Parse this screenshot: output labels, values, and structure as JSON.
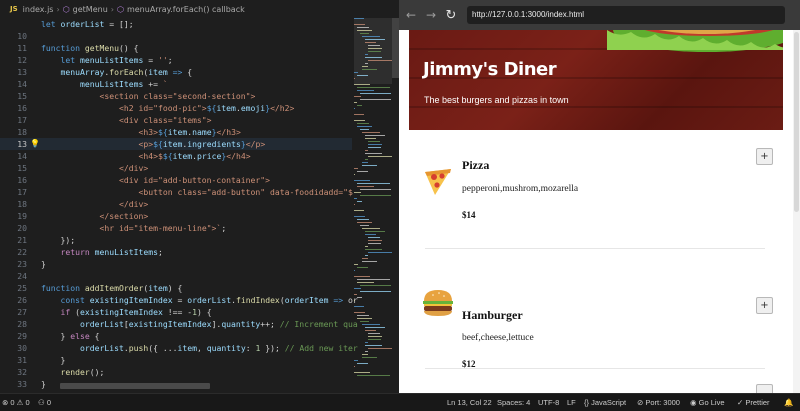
{
  "breadcrumb": {
    "lang": "JS",
    "file": "index.js",
    "sep": "›",
    "fn": "getMenu",
    "cb": "menuArray.forEach() callback"
  },
  "code_lines": [
    {
      "n": "",
      "tokens": [
        [
          "t-kw",
          "let "
        ],
        [
          "t-var",
          "orderList"
        ],
        [
          "t-op",
          " = [];"
        ]
      ]
    },
    {
      "n": "10",
      "tokens": []
    },
    {
      "n": "11",
      "tokens": [
        [
          "t-kw",
          "function "
        ],
        [
          "t-fn",
          "getMenu"
        ],
        [
          "t-op",
          "() {"
        ]
      ]
    },
    {
      "n": "12",
      "tokens": [
        [
          "t-op",
          "    "
        ],
        [
          "t-kw",
          "let "
        ],
        [
          "t-var",
          "menuListItems"
        ],
        [
          "t-op",
          " = "
        ],
        [
          "t-str",
          "''"
        ],
        [
          "t-op",
          ";"
        ]
      ]
    },
    {
      "n": "13",
      "tokens": [
        [
          "t-op",
          "    "
        ],
        [
          "t-var",
          "menuArray"
        ],
        [
          "t-op",
          "."
        ],
        [
          "t-fn",
          "forEach"
        ],
        [
          "t-op",
          "("
        ],
        [
          "t-var",
          "item"
        ],
        [
          "t-op",
          " "
        ],
        [
          "t-kw",
          "=>"
        ],
        [
          "t-op",
          " {"
        ]
      ]
    },
    {
      "n": "14",
      "tokens": [
        [
          "t-op",
          "        "
        ],
        [
          "t-var",
          "menuListItems"
        ],
        [
          "t-op",
          " += "
        ],
        [
          "t-str",
          "`"
        ]
      ]
    },
    {
      "n": "15",
      "tokens": [
        [
          "t-op",
          "            "
        ],
        [
          "t-str",
          "<section class=\"second-section\">"
        ]
      ]
    },
    {
      "n": "16",
      "tokens": [
        [
          "t-op",
          "                "
        ],
        [
          "t-str",
          "<h2 id=\"food-pic\">"
        ],
        [
          "t-kw",
          "${"
        ],
        [
          "t-var",
          "item"
        ],
        [
          "t-op",
          "."
        ],
        [
          "t-var",
          "emoji"
        ],
        [
          "t-kw",
          "}"
        ],
        [
          "t-str",
          "</h2>"
        ]
      ]
    },
    {
      "n": "17",
      "tokens": [
        [
          "t-op",
          "                "
        ],
        [
          "t-str",
          "<div class=\"items\">"
        ]
      ]
    },
    {
      "n": "18",
      "tokens": [
        [
          "t-op",
          "                    "
        ],
        [
          "t-str",
          "<h3>"
        ],
        [
          "t-kw",
          "${"
        ],
        [
          "t-var",
          "item"
        ],
        [
          "t-op",
          "."
        ],
        [
          "t-var",
          "name"
        ],
        [
          "t-kw",
          "}"
        ],
        [
          "t-str",
          "</h3>"
        ]
      ]
    },
    {
      "n": "13",
      "cur": true,
      "bulb": true,
      "tokens": [
        [
          "t-op",
          "                    "
        ],
        [
          "t-str",
          "<p>"
        ],
        [
          "t-kw",
          "${"
        ],
        [
          "t-var",
          "item"
        ],
        [
          "t-op",
          "."
        ],
        [
          "t-var",
          "ingredients"
        ],
        [
          "t-kw",
          "}"
        ],
        [
          "t-str",
          "</p>"
        ]
      ]
    },
    {
      "n": "14",
      "tokens": [
        [
          "t-op",
          "                    "
        ],
        [
          "t-str",
          "<h4>$"
        ],
        [
          "t-kw",
          "${"
        ],
        [
          "t-var",
          "item"
        ],
        [
          "t-op",
          "."
        ],
        [
          "t-var",
          "price"
        ],
        [
          "t-kw",
          "}"
        ],
        [
          "t-str",
          "</h4>"
        ]
      ]
    },
    {
      "n": "15",
      "tokens": [
        [
          "t-op",
          "                "
        ],
        [
          "t-str",
          "</div>"
        ]
      ]
    },
    {
      "n": "16",
      "tokens": [
        [
          "t-op",
          "                "
        ],
        [
          "t-str",
          "<div id=\"add-button-container\">"
        ]
      ]
    },
    {
      "n": "17",
      "tokens": [
        [
          "t-op",
          "                    "
        ],
        [
          "t-str",
          "<button class=\"add-button\" data-foodidadd=\"$"
        ]
      ]
    },
    {
      "n": "18",
      "tokens": [
        [
          "t-op",
          "                "
        ],
        [
          "t-str",
          "</div>"
        ]
      ]
    },
    {
      "n": "19",
      "tokens": [
        [
          "t-op",
          "            "
        ],
        [
          "t-str",
          "</section>"
        ]
      ]
    },
    {
      "n": "20",
      "tokens": [
        [
          "t-op",
          "            "
        ],
        [
          "t-str",
          "<hr id=\"item-menu-line\">`"
        ],
        [
          "t-op",
          ";"
        ]
      ]
    },
    {
      "n": "21",
      "tokens": [
        [
          "t-op",
          "    });"
        ]
      ]
    },
    {
      "n": "22",
      "tokens": [
        [
          "t-op",
          "    "
        ],
        [
          "t-ctl",
          "return "
        ],
        [
          "t-var",
          "menuListItems"
        ],
        [
          "t-op",
          ";"
        ]
      ]
    },
    {
      "n": "23",
      "tokens": [
        [
          "t-op",
          "}"
        ]
      ]
    },
    {
      "n": "24",
      "tokens": []
    },
    {
      "n": "25",
      "tokens": [
        [
          "t-kw",
          "function "
        ],
        [
          "t-fn",
          "addItemOrder"
        ],
        [
          "t-op",
          "("
        ],
        [
          "t-var",
          "item"
        ],
        [
          "t-op",
          ") {"
        ]
      ]
    },
    {
      "n": "26",
      "tokens": [
        [
          "t-op",
          "    "
        ],
        [
          "t-kw",
          "const "
        ],
        [
          "t-var",
          "existingItemIndex"
        ],
        [
          "t-op",
          " = "
        ],
        [
          "t-var",
          "orderList"
        ],
        [
          "t-op",
          "."
        ],
        [
          "t-fn",
          "findIndex"
        ],
        [
          "t-op",
          "("
        ],
        [
          "t-var",
          "orderItem"
        ],
        [
          "t-op",
          " "
        ],
        [
          "t-kw",
          "=>"
        ],
        [
          "t-op",
          " or"
        ]
      ]
    },
    {
      "n": "27",
      "tokens": [
        [
          "t-op",
          "    "
        ],
        [
          "t-ctl",
          "if "
        ],
        [
          "t-op",
          "("
        ],
        [
          "t-var",
          "existingItemIndex"
        ],
        [
          "t-op",
          " !== -"
        ],
        [
          "t-num",
          "1"
        ],
        [
          "t-op",
          ") {"
        ]
      ]
    },
    {
      "n": "28",
      "tokens": [
        [
          "t-op",
          "        "
        ],
        [
          "t-var",
          "orderList"
        ],
        [
          "t-op",
          "["
        ],
        [
          "t-var",
          "existingItemIndex"
        ],
        [
          "t-op",
          "]."
        ],
        [
          "t-var",
          "quantity"
        ],
        [
          "t-op",
          "++; "
        ],
        [
          "t-com",
          "// Increment qua"
        ]
      ]
    },
    {
      "n": "29",
      "tokens": [
        [
          "t-op",
          "    } "
        ],
        [
          "t-ctl",
          "else "
        ],
        [
          "t-op",
          "{"
        ]
      ]
    },
    {
      "n": "30",
      "tokens": [
        [
          "t-op",
          "        "
        ],
        [
          "t-var",
          "orderList"
        ],
        [
          "t-op",
          "."
        ],
        [
          "t-fn",
          "push"
        ],
        [
          "t-op",
          "({ ..."
        ],
        [
          "t-var",
          "item"
        ],
        [
          "t-op",
          ", "
        ],
        [
          "t-var",
          "quantity"
        ],
        [
          "t-op",
          ": "
        ],
        [
          "t-num",
          "1"
        ],
        [
          "t-op",
          " }); "
        ],
        [
          "t-com",
          "// Add new iter"
        ]
      ]
    },
    {
      "n": "31",
      "tokens": [
        [
          "t-op",
          "    }"
        ]
      ]
    },
    {
      "n": "32",
      "tokens": [
        [
          "t-op",
          "    "
        ],
        [
          "t-fn",
          "render"
        ],
        [
          "t-op",
          "();"
        ]
      ]
    },
    {
      "n": "33",
      "tokens": [
        [
          "t-op",
          "}"
        ]
      ]
    },
    {
      "n": "34",
      "tokens": []
    }
  ],
  "browser": {
    "url": "http://127.0.0.1:3000/index.html",
    "back_icon": "←",
    "forward_icon": "→",
    "reload_icon": "↻"
  },
  "site": {
    "title": "Jimmy's Diner",
    "subtitle": "The best burgers and pizzas in town",
    "items": [
      {
        "name": "Pizza",
        "ingredients": "pepperoni,mushrom,mozarella",
        "price": "$14",
        "emoji": "pizza-icon",
        "add_label": "+"
      },
      {
        "name": "Hamburger",
        "ingredients": "beef,cheese,lettuce",
        "price": "$12",
        "emoji": "hamburger-icon",
        "add_label": "+"
      }
    ]
  },
  "statusbar": {
    "errors": "0",
    "warnings": "0",
    "ports": "0",
    "position": "Ln 13, Col 22",
    "spaces": "Spaces: 4",
    "encoding": "UTF-8",
    "eol": "LF",
    "language": "JavaScript",
    "port": "Port: 3000",
    "golive": "Go Live",
    "prettier": "Prettier"
  }
}
